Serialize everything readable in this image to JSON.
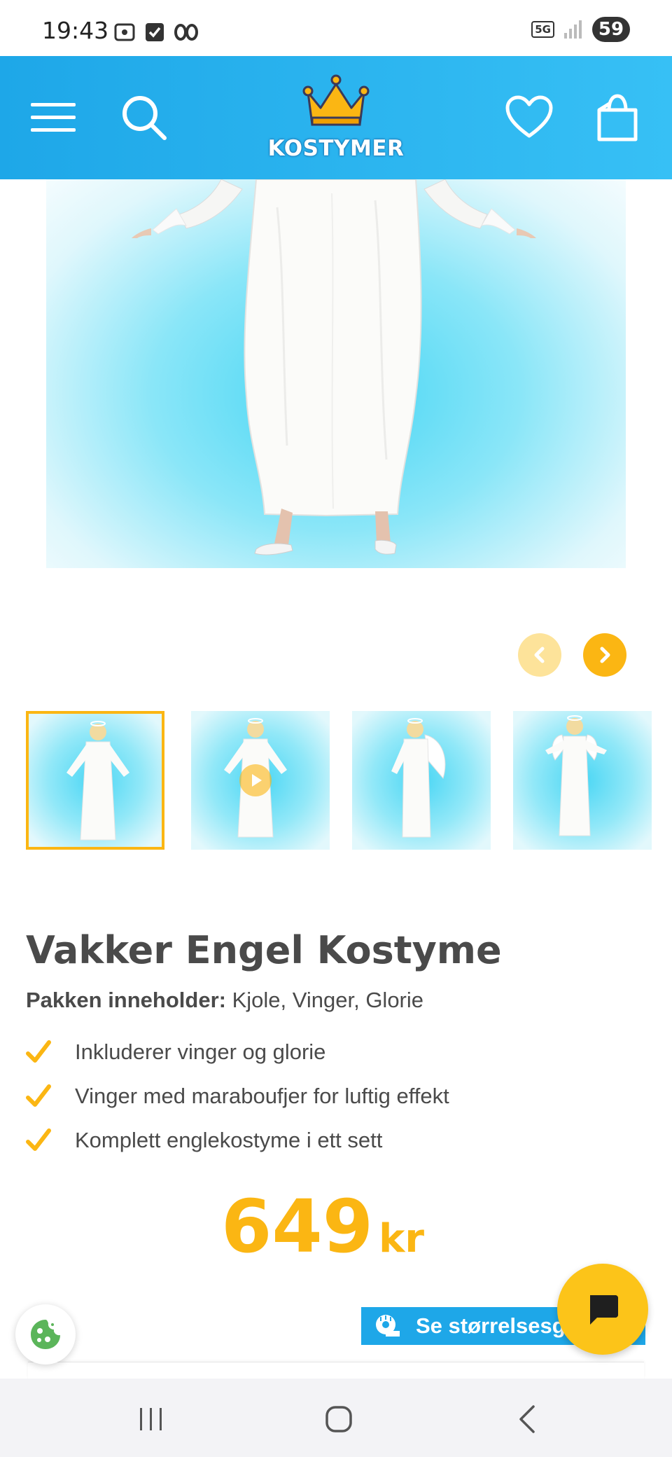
{
  "status_bar": {
    "time": "19:43",
    "network": "5G",
    "battery": "59"
  },
  "header": {
    "logo_text": "KOSTYMER",
    "icons": [
      "menu-icon",
      "search-icon",
      "heart-icon",
      "shopping-bag-icon"
    ],
    "brand_colors": {
      "header_start": "#1ea7e8",
      "header_end": "#37c0f5",
      "crown": "#fbb613"
    }
  },
  "gallery": {
    "thumbnails": [
      {
        "label": "thumbnail-1",
        "selected": true
      },
      {
        "label": "thumbnail-2",
        "video": true
      },
      {
        "label": "thumbnail-3"
      },
      {
        "label": "thumbnail-4"
      }
    ]
  },
  "product": {
    "title": "Vakker Engel Kostyme",
    "package_label": "Pakken inneholder:",
    "package_contents": "Kjole, Vinger, Glorie",
    "features": [
      "Inkluderer vinger og glorie",
      "Vinger med maraboufjer for luftig effekt",
      "Komplett englekostyme i ett sett"
    ],
    "price_amount": "649",
    "price_currency": "kr",
    "accent_color": "#fbb613"
  },
  "size_guide": {
    "label": "Se størrelsesg"
  }
}
